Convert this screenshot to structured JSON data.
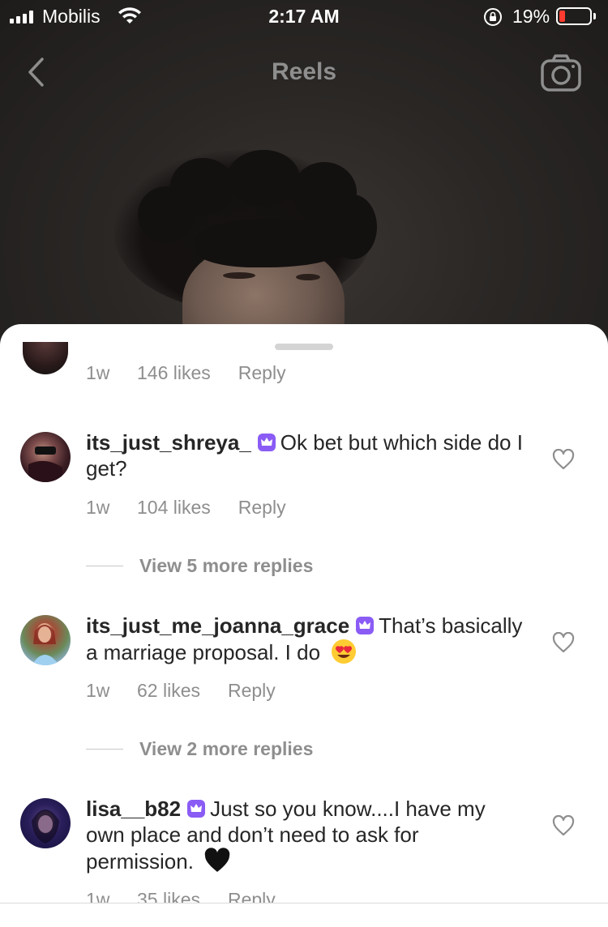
{
  "status_bar": {
    "carrier": "Mobilis",
    "time": "2:17 AM",
    "battery_percent": "19%",
    "battery_level": 0.19,
    "battery_color": "#ff3b30"
  },
  "nav": {
    "title": "Reels",
    "back_icon": "chevron-left-icon",
    "camera_icon": "camera-icon"
  },
  "comments": {
    "partial_top": {
      "time": "1w",
      "likes": "146 likes",
      "reply": "Reply"
    },
    "items": [
      {
        "username": "its_just_shreya_",
        "text": "Ok bet but which side do I get?",
        "time": "1w",
        "likes": "104 likes",
        "reply": "Reply",
        "view_more": "View 5 more replies"
      },
      {
        "username": "its_just_me_joanna_grace",
        "text": "That’s basically a marriage proposal. I do",
        "emoji": "heart-eyes-emoji",
        "time": "1w",
        "likes": "62 likes",
        "reply": "Reply",
        "view_more": "View 2 more replies"
      },
      {
        "username": "lisa__b82",
        "text": "Just so you know....I have my own place and don’t need to ask for permission.",
        "emoji": "black-heart-emoji",
        "time": "1w",
        "likes": "35 likes",
        "reply": "Reply"
      }
    ],
    "badge_color": "#8a5cf5",
    "badge_icon": "crown-icon",
    "like_icon": "heart-outline-icon"
  }
}
